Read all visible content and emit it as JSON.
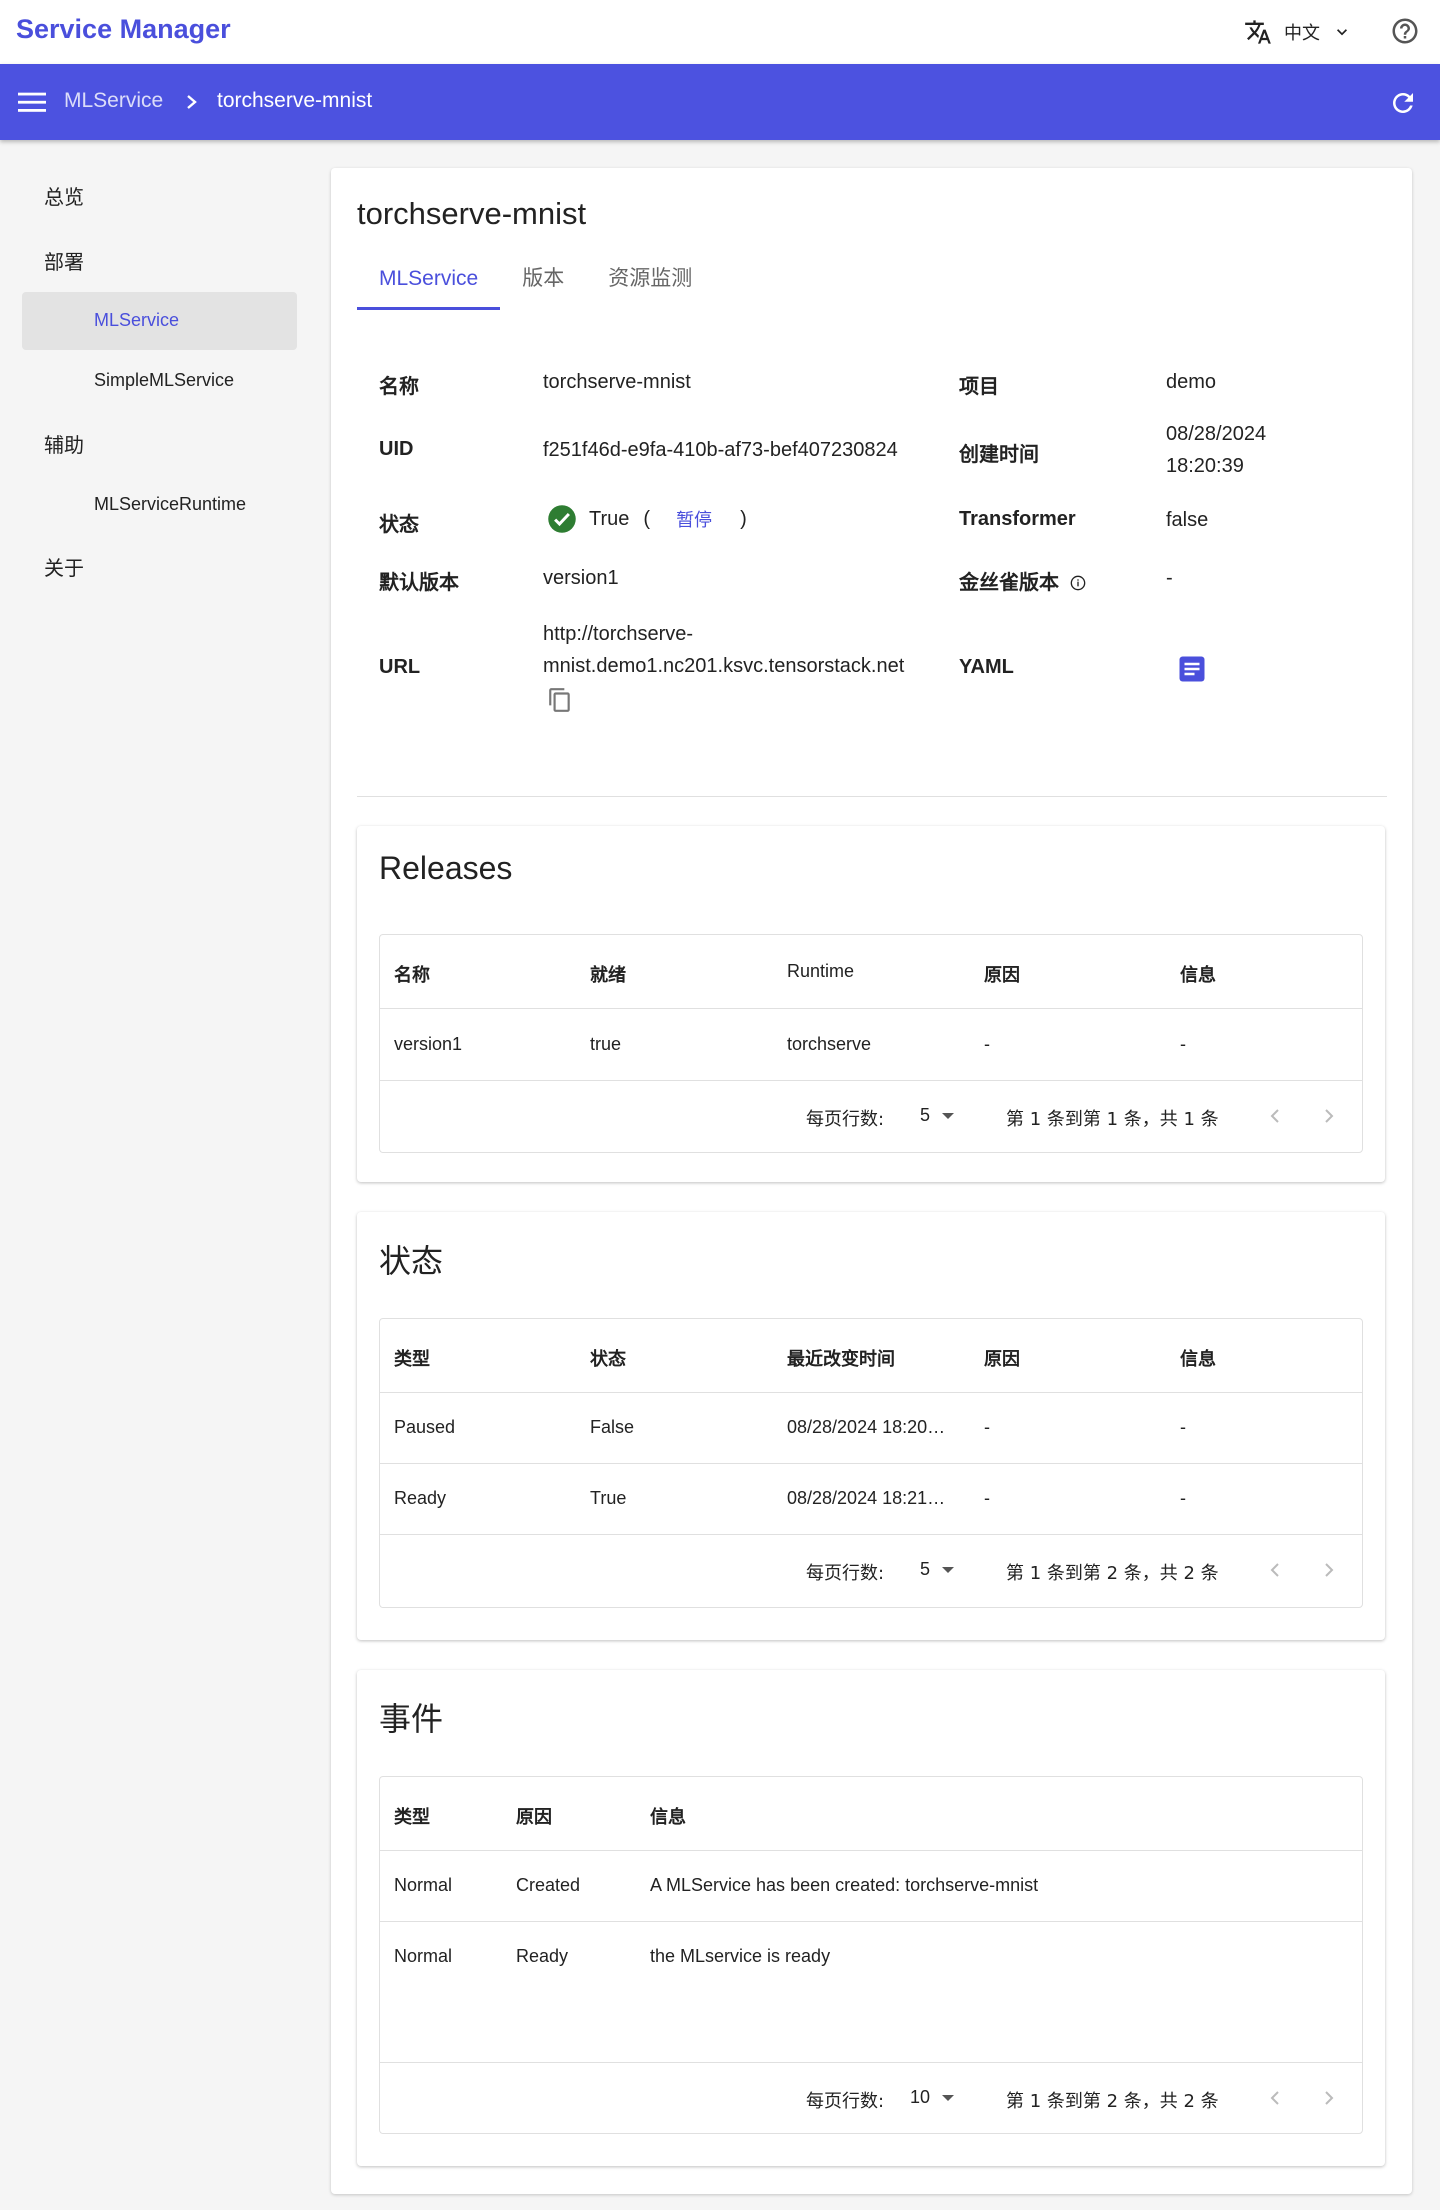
{
  "app": {
    "title": "Service Manager",
    "language": "中文"
  },
  "breadcrumb": {
    "root": "MLService",
    "current": "torchserve-mnist"
  },
  "sidebar": {
    "overview": "总览",
    "deploy_group": "部署",
    "deploy_items": [
      "MLService",
      "SimpleMLService"
    ],
    "aux_group": "辅助",
    "aux_items": [
      "MLServiceRuntime"
    ],
    "about": "关于"
  },
  "page": {
    "title": "torchserve-mnist",
    "tabs": [
      "MLService",
      "版本",
      "资源监测"
    ]
  },
  "details": {
    "name_label": "名称",
    "name": "torchserve-mnist",
    "project_label": "项目",
    "project": "demo",
    "uid_label": "UID",
    "uid": "f251f46d-e9fa-410b-af73-bef407230824",
    "created_label": "创建时间",
    "created_date": "08/28/2024",
    "created_time": "18:20:39",
    "status_label": "状态",
    "status_value": "True",
    "status_open": "(",
    "status_action": "暂停",
    "status_close": ")",
    "transformer_label": "Transformer",
    "transformer": "false",
    "default_version_label": "默认版本",
    "default_version": "version1",
    "canary_label": "金丝雀版本",
    "canary": "-",
    "url_label": "URL",
    "url_line1": "http://torchserve-",
    "url_line2": "mnist.demo1.nc201.ksvc.tensorstack.net",
    "yaml_label": "YAML"
  },
  "releases": {
    "title": "Releases",
    "columns": [
      "名称",
      "就绪",
      "Runtime",
      "原因",
      "信息"
    ],
    "rows": [
      [
        "version1",
        "true",
        "torchserve",
        "-",
        "-"
      ]
    ],
    "pager": {
      "rows_per_page_label": "每页行数:",
      "rows_per_page": "5",
      "range": "第 1 条到第 1 条，共 1 条"
    }
  },
  "conditions": {
    "title": "状态",
    "columns": [
      "类型",
      "状态",
      "最近改变时间",
      "原因",
      "信息"
    ],
    "rows": [
      [
        "Paused",
        "False",
        "08/28/2024 18:20…",
        "-",
        "-"
      ],
      [
        "Ready",
        "True",
        "08/28/2024 18:21…",
        "-",
        "-"
      ]
    ],
    "pager": {
      "rows_per_page_label": "每页行数:",
      "rows_per_page": "5",
      "range": "第 1 条到第 2 条，共 2 条"
    }
  },
  "events": {
    "title": "事件",
    "columns": [
      "类型",
      "原因",
      "信息"
    ],
    "rows": [
      [
        "Normal",
        "Created",
        "A MLService has been created: torchserve-mnist"
      ],
      [
        "Normal",
        "Ready",
        "the MLservice is ready"
      ]
    ],
    "pager": {
      "rows_per_page_label": "每页行数:",
      "rows_per_page": "10",
      "range": "第 1 条到第 2 条，共 2 条"
    }
  },
  "colors": {
    "brand": "#4a4fdc",
    "bar": "#4c52e0",
    "success": "#2e7d32"
  }
}
